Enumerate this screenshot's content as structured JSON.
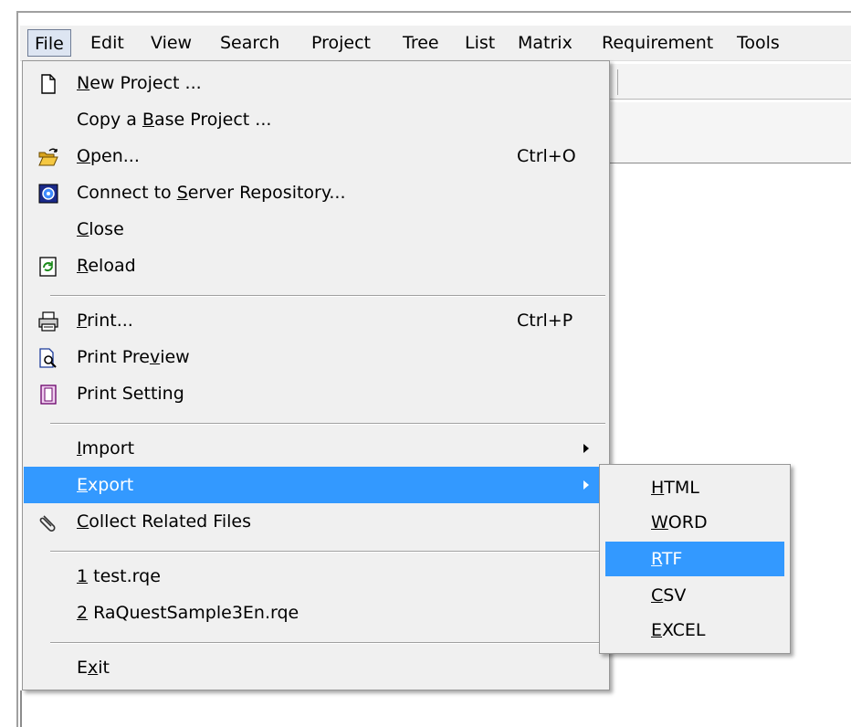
{
  "menubar": {
    "items": [
      {
        "label": "File"
      },
      {
        "label": "Edit"
      },
      {
        "label": "View"
      },
      {
        "label": "Search"
      },
      {
        "label": "Project"
      },
      {
        "label": "Tree"
      },
      {
        "label": "List"
      },
      {
        "label": "Matrix"
      },
      {
        "label": "Requirement"
      },
      {
        "label": "Tools"
      }
    ]
  },
  "file_menu": {
    "new_project": {
      "pre": "",
      "u": "N",
      "post": "ew Project ...",
      "icon": "new-page-icon"
    },
    "copy_base_project": {
      "pre": "Copy a ",
      "u": "B",
      "post": "ase Project ..."
    },
    "open": {
      "pre": "",
      "u": "O",
      "post": "pen...",
      "shortcut": "Ctrl+O",
      "icon": "open-folder-icon"
    },
    "connect_server": {
      "pre": "Connect to ",
      "u": "S",
      "post": "erver Repository...",
      "icon": "server-icon"
    },
    "close": {
      "pre": "",
      "u": "C",
      "post": "lose"
    },
    "reload": {
      "pre": "",
      "u": "R",
      "post": "eload",
      "icon": "reload-icon"
    },
    "print": {
      "pre": "",
      "u": "P",
      "post": "rint...",
      "shortcut": "Ctrl+P",
      "icon": "printer-icon"
    },
    "print_preview": {
      "pre": "Print Pre",
      "u": "v",
      "post": "iew",
      "icon": "print-preview-icon"
    },
    "print_setting": {
      "pre": "Print Setting",
      "u": "",
      "post": "",
      "icon": "page-setup-icon"
    },
    "import": {
      "pre": "",
      "u": "I",
      "post": "mport"
    },
    "export": {
      "pre": "",
      "u": "E",
      "post": "xport"
    },
    "collect_files": {
      "pre": "",
      "u": "C",
      "post": "ollect Related Files",
      "icon": "paperclip-icon"
    },
    "recent1": {
      "pre": "",
      "u": "1",
      "post": " test.rqe"
    },
    "recent2": {
      "pre": "",
      "u": "2",
      "post": " RaQuestSample3En.rqe"
    },
    "exit": {
      "pre": "E",
      "u": "x",
      "post": "it"
    }
  },
  "export_submenu": {
    "html": {
      "u": "H",
      "post": "TML"
    },
    "word": {
      "u": "W",
      "post": "ORD"
    },
    "rtf": {
      "u": "R",
      "post": "TF"
    },
    "csv": {
      "u": "C",
      "post": "SV"
    },
    "excel": {
      "u": "E",
      "post": "XCEL"
    }
  },
  "colors": {
    "highlight": "#3399ff",
    "menu_bg": "#f0f0f0"
  }
}
